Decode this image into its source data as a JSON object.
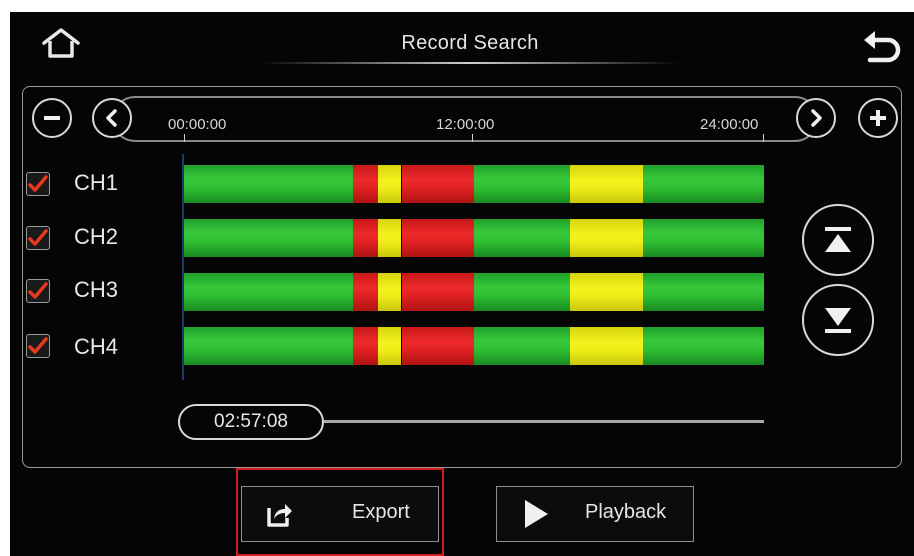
{
  "header": {
    "title": "Record Search",
    "home_icon": "home-icon",
    "back_icon": "back-arrow-icon"
  },
  "timeline": {
    "ticks": [
      "00:00:00",
      "12:00:00",
      "24:00:00"
    ],
    "zoom_out_icon": "minus-icon",
    "zoom_in_icon": "plus-icon",
    "prev_icon": "chevron-left-icon",
    "next_icon": "chevron-right-icon"
  },
  "channels": [
    {
      "label": "CH1",
      "checked": true
    },
    {
      "label": "CH2",
      "checked": true
    },
    {
      "label": "CH3",
      "checked": true
    },
    {
      "label": "CH4",
      "checked": true
    }
  ],
  "record_segments": [
    {
      "type": "normal",
      "start": 0.0,
      "end": 0.291
    },
    {
      "type": "alarm",
      "start": 0.291,
      "end": 0.334
    },
    {
      "type": "motion",
      "start": 0.334,
      "end": 0.375
    },
    {
      "type": "alarm",
      "start": 0.375,
      "end": 0.5
    },
    {
      "type": "normal",
      "start": 0.5,
      "end": 0.666
    },
    {
      "type": "motion",
      "start": 0.666,
      "end": 0.792
    },
    {
      "type": "normal",
      "start": 0.792,
      "end": 1.0
    }
  ],
  "segment_colors": {
    "normal": "#2fbf33",
    "alarm": "#e02222",
    "motion": "#efee1a"
  },
  "scroll": {
    "up_icon": "scroll-top-icon",
    "down_icon": "scroll-bottom-icon"
  },
  "current_time": "02:57:08",
  "buttons": {
    "export_label": "Export",
    "export_icon": "share-export-icon",
    "playback_label": "Playback",
    "playback_icon": "play-icon"
  },
  "colors": {
    "highlight": "#d41d1d",
    "checkmark": "#e8391f"
  }
}
